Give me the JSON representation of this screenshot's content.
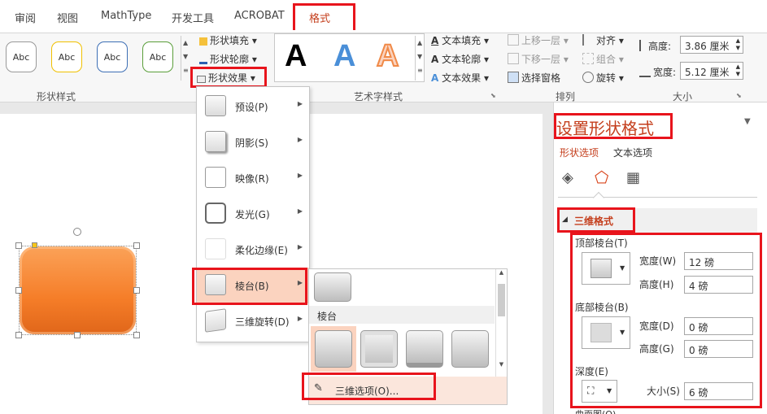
{
  "tabs": [
    "审阅",
    "视图",
    "MathType",
    "开发工具",
    "ACROBAT",
    "格式"
  ],
  "shape_styles": {
    "samples": [
      "Abc",
      "Abc",
      "Abc",
      "Abc"
    ],
    "fill": "形状填充",
    "outline": "形状轮廓",
    "effects": "形状效果",
    "group_label": "形状样式"
  },
  "wordart": {
    "letters": [
      "A",
      "A",
      "A"
    ],
    "text_fill": "文本填充",
    "text_outline": "文本轮廓",
    "text_effects": "文本效果",
    "group_label": "艺术字样式"
  },
  "arrange": {
    "bring_forward": "上移一层",
    "send_backward": "下移一层",
    "selection_pane": "选择窗格",
    "align": "对齐",
    "group": "组合",
    "rotate": "旋转",
    "group_label": "排列"
  },
  "size": {
    "height_label": "高度:",
    "height_value": "3.86 厘米",
    "width_label": "宽度:",
    "width_value": "5.12 厘米",
    "group_label": "大小"
  },
  "effects_menu": [
    "预设(P)",
    "阴影(S)",
    "映像(R)",
    "发光(G)",
    "柔化边缘(E)",
    "棱台(B)",
    "三维旋转(D)"
  ],
  "bevel_submenu": {
    "section": "棱台",
    "options_link": "三维选项(O)..."
  },
  "format_pane": {
    "title": "设置形状格式",
    "tab_shape": "形状选项",
    "tab_text": "文本选项",
    "section": "三维格式",
    "top_bevel": "顶部棱台(T)",
    "top_width_label": "宽度(W)",
    "top_width": "12 磅",
    "top_height_label": "高度(H)",
    "top_height": "4 磅",
    "bottom_bevel": "底部棱台(B)",
    "bottom_width_label": "宽度(D)",
    "bottom_width": "0 磅",
    "bottom_height_label": "高度(G)",
    "bottom_height": "0 磅",
    "depth": "深度(E)",
    "size_label": "大小(S)",
    "size_value": "6 磅",
    "contour": "曲面图(O)"
  },
  "colors": {
    "accent_red": "#e8141c",
    "shape_orange": "#f57d28",
    "selected": "#fbd3bf"
  }
}
